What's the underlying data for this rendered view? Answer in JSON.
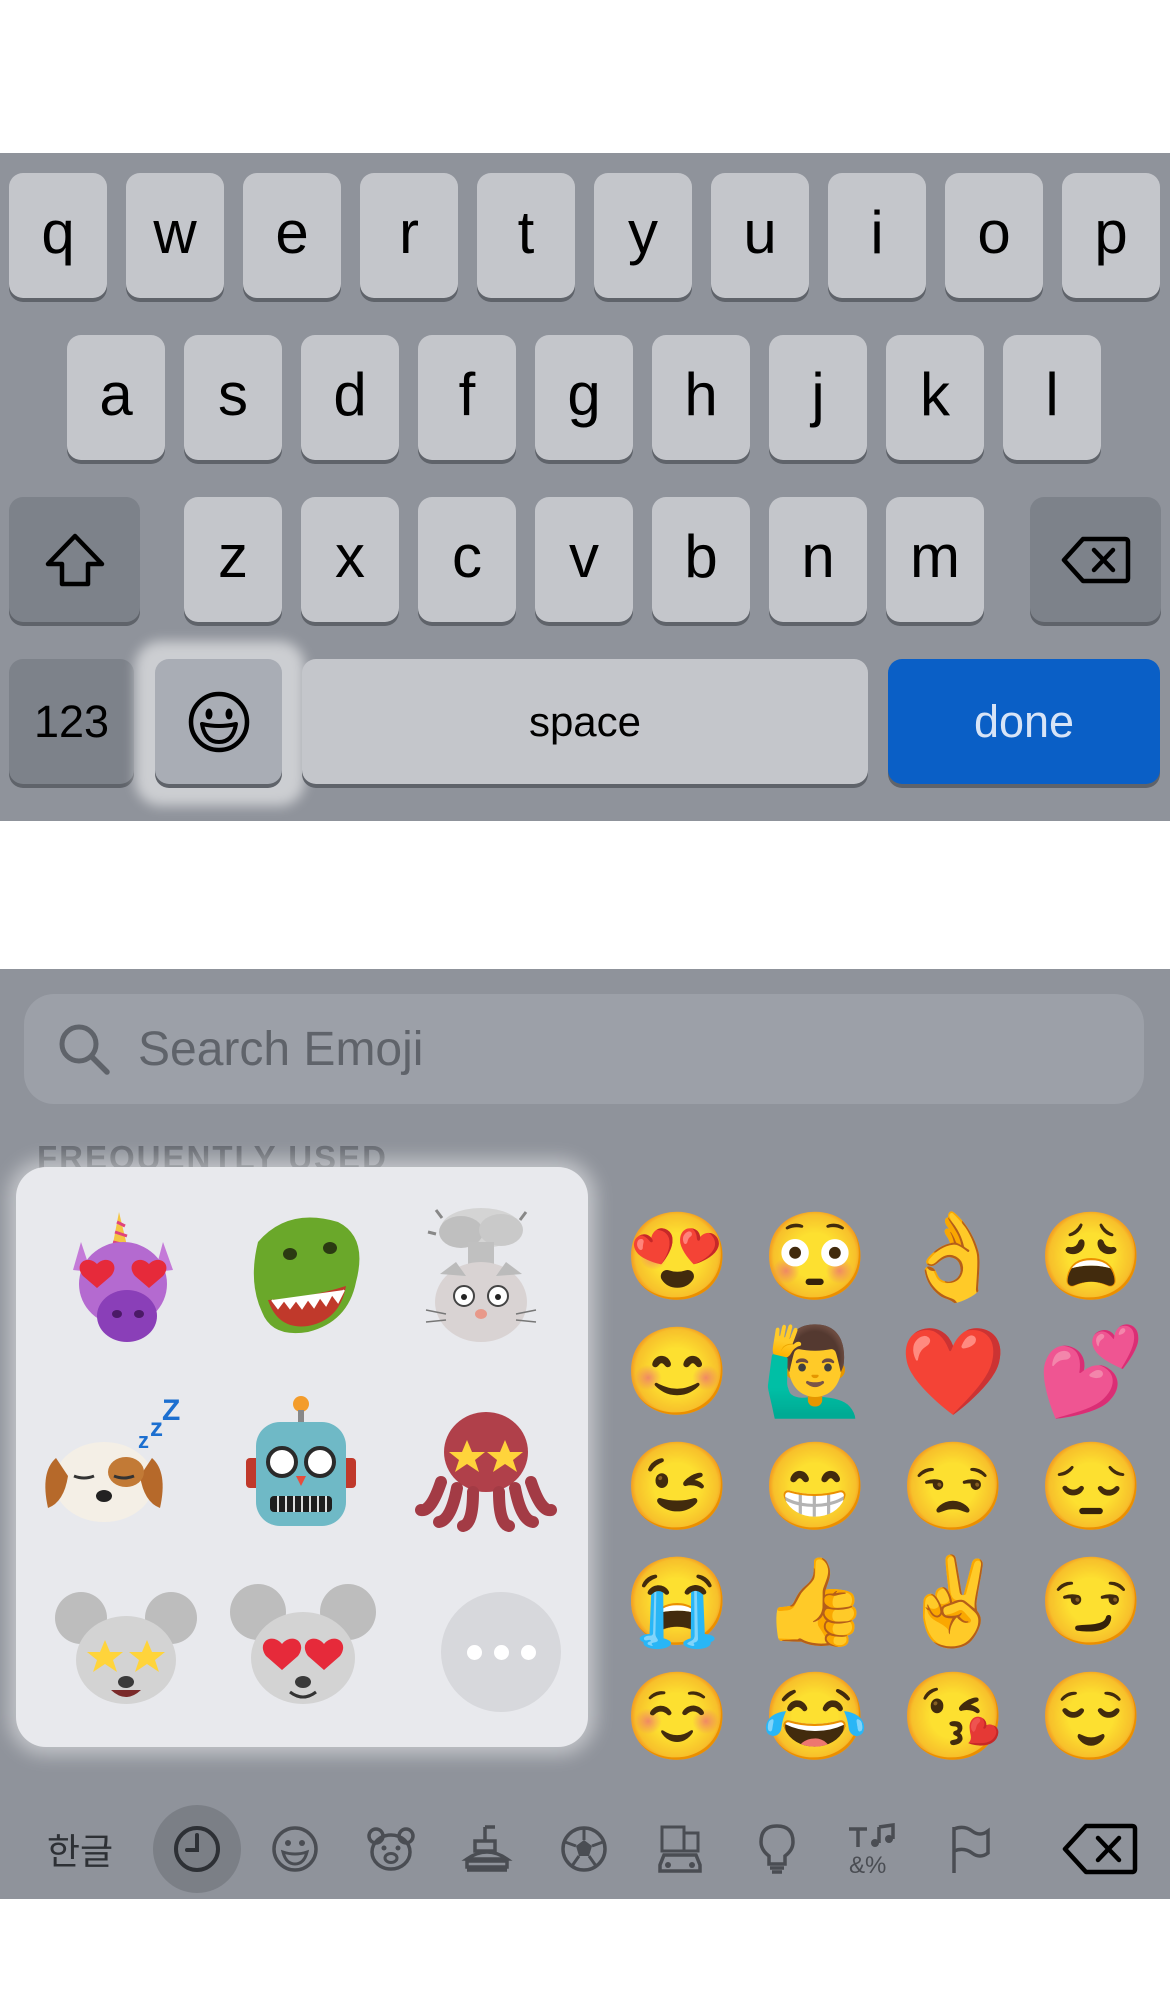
{
  "keyboard": {
    "row1": [
      "q",
      "w",
      "e",
      "r",
      "t",
      "y",
      "u",
      "i",
      "o",
      "p"
    ],
    "row2": [
      "a",
      "s",
      "d",
      "f",
      "g",
      "h",
      "j",
      "k",
      "l"
    ],
    "row3": [
      "z",
      "x",
      "c",
      "v",
      "b",
      "n",
      "m"
    ],
    "numbers_label": "123",
    "space_label": "space",
    "done_label": "done",
    "shift_icon": "shift-arrow-icon",
    "delete_icon": "backspace-icon",
    "emoji_icon": "smiley-face-icon",
    "colors": {
      "background": "#8f939b",
      "key": "#c4c6cb",
      "done": "#0a5fc6"
    }
  },
  "emoji_keyboard": {
    "search_placeholder": "Search Emoji",
    "section_title": "FREQUENTLY USED",
    "memoji": [
      "unicorn-heart-eyes-memoji",
      "dinosaur-memoji",
      "mind-blown-rabbit-memoji",
      "sleeping-dog-memoji",
      "robot-memoji",
      "star-struck-octopus-memoji",
      "star-struck-mouse-memoji",
      "heart-eyes-mouse-memoji"
    ],
    "more_label": "more-memoji",
    "emojis": [
      "😍",
      "😳",
      "👌",
      "😩",
      "😊",
      "🙋‍♂️",
      "❤️",
      "💕",
      "😉",
      "😁",
      "😒",
      "😔",
      "😭",
      "👍",
      "✌️",
      "😏",
      "☺️",
      "😂",
      "😘",
      "😌"
    ],
    "categories": {
      "korean_label": "한글",
      "icons": [
        "recent-clock-icon",
        "smileys-icon",
        "animals-bear-icon",
        "food-drink-icon",
        "activity-soccer-icon",
        "travel-car-icon",
        "objects-lightbulb-icon",
        "symbols-icon",
        "flags-icon"
      ],
      "delete_icon": "backspace-icon"
    }
  }
}
